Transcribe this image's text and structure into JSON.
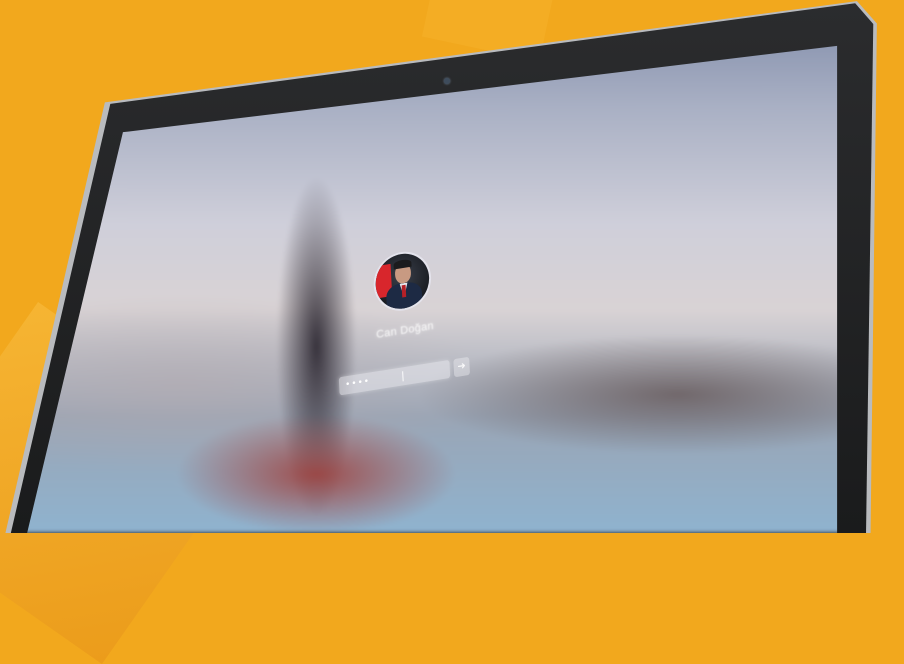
{
  "login": {
    "username": "Can Doğan",
    "password_mask": "••••"
  },
  "colors": {
    "background": "#f2a81d",
    "bezel": "#1a1b1c",
    "flag_red": "#d8262c"
  },
  "icons": {
    "camera": "camera-icon",
    "submit": "arrow-right-icon"
  }
}
